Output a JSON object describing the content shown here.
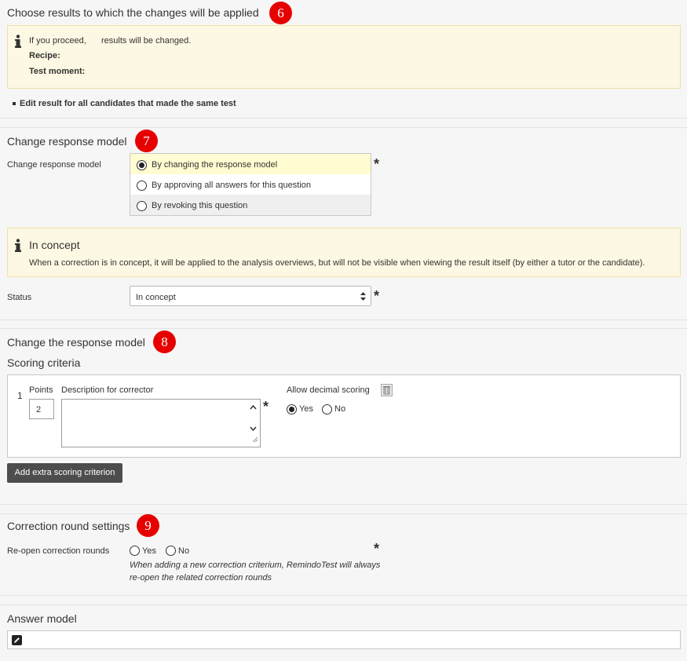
{
  "section6": {
    "title": "Choose results to which the changes will be applied",
    "badge": "6",
    "info": {
      "line1_prefix": "If you proceed,",
      "line1_suffix": "results will be changed.",
      "recipe_label": "Recipe:",
      "test_moment_label": "Test moment:"
    },
    "edit_all_label": "Edit result for all candidates that made the same test"
  },
  "section7": {
    "title": "Change response model",
    "badge": "7",
    "field_label": "Change response model",
    "options": [
      {
        "label": "By changing the response model",
        "checked": true
      },
      {
        "label": "By approving all answers for this question",
        "checked": false
      },
      {
        "label": "By revoking this question",
        "checked": false
      }
    ],
    "concept_info": {
      "title": "In concept",
      "text": "When a correction is in concept, it will be applied to the analysis overviews, but will not be visible when viewing the result itself (by either a tutor or the candidate)."
    },
    "status_label": "Status",
    "status_value": "In concept"
  },
  "section8": {
    "title": "Change the response model",
    "badge": "8",
    "subtitle": "Scoring criteria",
    "criterion": {
      "index": "1",
      "points_label": "Points",
      "points_value": "2",
      "description_label": "Description for corrector",
      "description_value": "",
      "decimal_label": "Allow decimal scoring",
      "yes_label": "Yes",
      "no_label": "No",
      "decimal_selected": "Yes"
    },
    "add_button": "Add extra scoring criterion"
  },
  "section9": {
    "title": "Correction round settings",
    "badge": "9",
    "reopen_label": "Re-open correction rounds",
    "yes_label": "Yes",
    "no_label": "No",
    "hint_line1": "When adding a new correction criterium, RemindoTest will always",
    "hint_line2": "re-open the related correction rounds"
  },
  "answer_model": {
    "title": "Answer model"
  },
  "required_marker": "*",
  "colors": {
    "badge": "#e60000",
    "info_bg": "#fdf8e3",
    "selected_row": "#fffcd1",
    "button": "#4d4d4d"
  },
  "icons": [
    "info-icon",
    "trash-icon",
    "pencil-icon",
    "select-arrows-icon",
    "scroll-up-icon",
    "scroll-down-icon",
    "resize-grip-icon"
  ]
}
